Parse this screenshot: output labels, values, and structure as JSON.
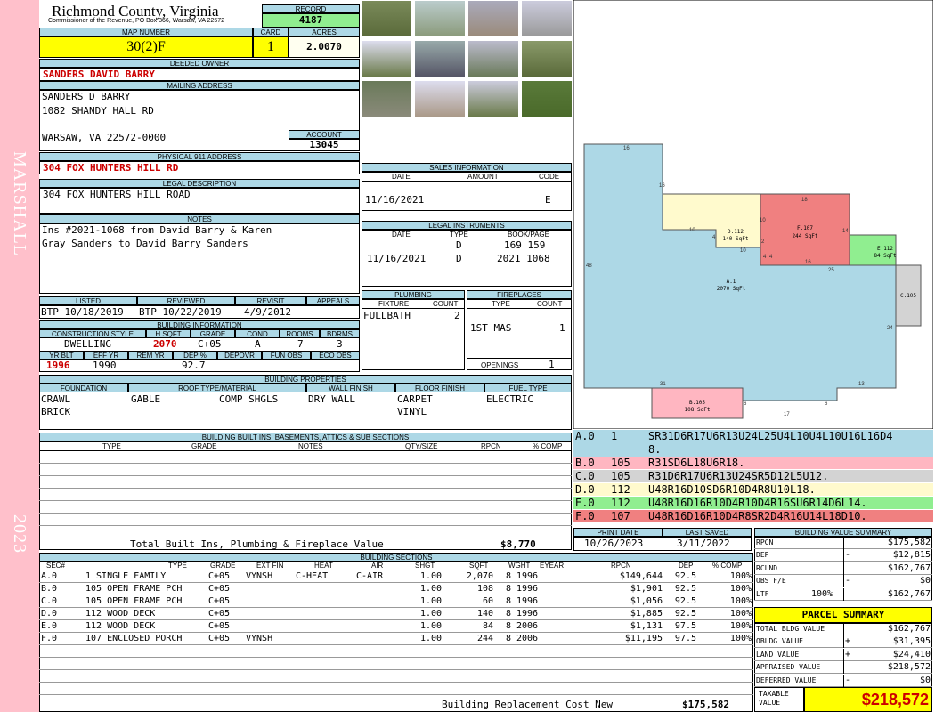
{
  "sidebar": {
    "district": "MARSHALL",
    "year": "2023"
  },
  "header": {
    "county": "Richmond County, Virginia",
    "commissioner": "Commissioner of the Revenue, PO Box 366, Warsaw, VA 22572"
  },
  "record": {
    "label": "RECORD",
    "value": "4187"
  },
  "map": {
    "label": "MAP NUMBER",
    "value": "30(2)F",
    "card_label": "CARD",
    "card": "1",
    "acres_label": "ACRES",
    "acres": "2.0070"
  },
  "owner": {
    "label": "DEEDED OWNER",
    "value": "SANDERS DAVID BARRY"
  },
  "mailing": {
    "label": "MAILING ADDRESS",
    "line1": "SANDERS D BARRY",
    "line2": "1082 SHANDY HALL RD",
    "line3": "WARSAW, VA 22572-0000"
  },
  "account": {
    "label": "ACCOUNT",
    "value": "13045"
  },
  "physical": {
    "label": "PHYSICAL 911 ADDRESS",
    "value": "304 FOX HUNTERS HILL RD"
  },
  "legal": {
    "label": "LEGAL DESCRIPTION",
    "value": "304 FOX HUNTERS HILL ROAD"
  },
  "notes": {
    "label": "NOTES",
    "line1": "Ins #2021-1068 from David Barry & Karen",
    "line2": "Gray Sanders to David Barry Sanders"
  },
  "sales": {
    "label": "SALES INFORMATION",
    "cols": [
      "DATE",
      "AMOUNT",
      "CODE"
    ],
    "date": "11/16/2021",
    "code": "E"
  },
  "instruments": {
    "label": "LEGAL INSTRUMENTS",
    "cols": [
      "DATE",
      "TYPE",
      "BOOK/PAGE"
    ],
    "rows": [
      {
        "date": "",
        "type": "D",
        "book": "169 159"
      },
      {
        "date": "11/16/2021",
        "type": "D",
        "book": "2021 1068"
      }
    ]
  },
  "listing": {
    "listed_label": "LISTED",
    "listed": "BTP 10/18/2019",
    "reviewed_label": "REVIEWED",
    "reviewed": "BTP 10/22/2019",
    "revisit_label": "REVISIT",
    "revisit": "4/9/2012",
    "appeals_label": "APPEALS",
    "appeals": ""
  },
  "building_info": {
    "label": "BUILDING INFORMATION",
    "cols": [
      "CONSTRUCTION STYLE",
      "H SQFT",
      "GRADE",
      "COND",
      "ROOMS",
      "BDRMS"
    ],
    "style": "DWELLING",
    "hsqft": "2070",
    "grade": "C+05",
    "cond": "A",
    "rooms": "7",
    "bdrms": "3",
    "cols2": [
      "YR BLT",
      "EFF YR",
      "REM YR",
      "DEP %",
      "DEPOVR",
      "FUN OBS",
      "ECO OBS"
    ],
    "yrblt": "1996",
    "effyr": "1990",
    "remyr": "",
    "dep": "92.7",
    "depovr": "",
    "funobs": "",
    "ecoobs": ""
  },
  "plumbing": {
    "label": "PLUMBING",
    "cols": [
      "FIXTURE",
      "COUNT"
    ],
    "fixture": "FULLBATH",
    "count": "2"
  },
  "fireplaces": {
    "label": "FIREPLACES",
    "cols": [
      "TYPE",
      "COUNT"
    ],
    "type": "1ST MAS",
    "count": "1",
    "openings_label": "OPENINGS",
    "openings": "1"
  },
  "properties": {
    "label": "BUILDING PROPERTIES",
    "cols": [
      "FOUNDATION",
      "ROOF TYPE/MATERIAL",
      "WALL FINISH",
      "FLOOR FINISH",
      "FUEL TYPE"
    ],
    "foundation1": "CRAWL",
    "foundation2": "BRICK",
    "roof1": "GABLE",
    "roof2": "COMP SHGLS",
    "wall": "DRY WALL",
    "floor1": "CARPET",
    "floor2": "VINYL",
    "fuel": "ELECTRIC"
  },
  "builtins": {
    "label": "BUILDING BUILT INS, BASEMENTS, ATTICS & SUB SECTIONS",
    "cols": [
      "TYPE",
      "GRADE",
      "NOTES",
      "QTY/SIZE",
      "RPCN",
      "% COMP"
    ],
    "total_label": "Total Built Ins, Plumbing & Fireplace Value",
    "total": "$8,770"
  },
  "sketch": {
    "areas": [
      {
        "code": "A.1",
        "sqft": "2070 SqFt"
      },
      {
        "code": "B.105",
        "sqft": "108 SqFt"
      },
      {
        "code": "C.105",
        "sqft": ""
      },
      {
        "code": "D.112",
        "sqft": "140 SqFt"
      },
      {
        "code": "E.112",
        "sqft": "84 SqFt"
      },
      {
        "code": "F.107",
        "sqft": "244 SqFt"
      }
    ],
    "dims": [
      "16",
      "16",
      "10",
      "4",
      "10",
      "2",
      "18",
      "10",
      "14",
      "4",
      "4",
      "16",
      "25",
      "48",
      "24",
      "31",
      "13",
      "6",
      "6",
      "17"
    ]
  },
  "vectors": [
    {
      "id": "A.0",
      "code": "1",
      "text": "SR31D6R17U6R13U24L25U4L10U4L10U16L16D4",
      "text2": "8.",
      "color": "#add8e6"
    },
    {
      "id": "B.0",
      "code": "105",
      "text": "R31SD6L18U6R18.",
      "color": "#ffb6c1"
    },
    {
      "id": "C.0",
      "code": "105",
      "text": "R31D6R17U6R13U24SR5D12L5U12.",
      "color": "#d3d3d3"
    },
    {
      "id": "D.0",
      "code": "112",
      "text": "U48R16D10SD6R10D4R8U10L18.",
      "color": "#fffacd"
    },
    {
      "id": "E.0",
      "code": "112",
      "text": "U48R16D16R10D4R10D4R16SU6R14D6L14.",
      "color": "#90ee90"
    },
    {
      "id": "F.0",
      "code": "107",
      "text": "U48R16D16R10D4R8SR2D4R16U14L18D10.",
      "color": "#f08080"
    }
  ],
  "print": {
    "label": "PRINT DATE",
    "value": "10/26/2023",
    "saved_label": "LAST SAVED",
    "saved": "3/11/2022"
  },
  "sections": {
    "label": "BUILDING SECTIONS",
    "cols": [
      "SEC#",
      "TYPE",
      "GRADE",
      "EXT FIN",
      "HEAT",
      "AIR",
      "SHGT",
      "SQFT",
      "WGHT",
      "EYEAR",
      "RPCN",
      "DEP",
      "% COMP"
    ],
    "rows": [
      {
        "sec": "A.0",
        "type": "1 SINGLE FAMILY",
        "grade": "C+05",
        "ext": "VYNSH",
        "heat": "C-HEAT",
        "air": "C-AIR",
        "shgt": "1.00",
        "sqft": "2,070",
        "wght": "8",
        "eyear": "1996",
        "rpcn": "$149,644",
        "dep": "92.5",
        "comp": "100%"
      },
      {
        "sec": "B.0",
        "type": "105 OPEN FRAME PCH",
        "grade": "C+05",
        "ext": "",
        "heat": "",
        "air": "",
        "shgt": "1.00",
        "sqft": "108",
        "wght": "8",
        "eyear": "1996",
        "rpcn": "$1,901",
        "dep": "92.5",
        "comp": "100%"
      },
      {
        "sec": "C.0",
        "type": "105 OPEN FRAME PCH",
        "grade": "C+05",
        "ext": "",
        "heat": "",
        "air": "",
        "shgt": "1.00",
        "sqft": "60",
        "wght": "8",
        "eyear": "1996",
        "rpcn": "$1,056",
        "dep": "92.5",
        "comp": "100%"
      },
      {
        "sec": "D.0",
        "type": "112 WOOD DECK",
        "grade": "C+05",
        "ext": "",
        "heat": "",
        "air": "",
        "shgt": "1.00",
        "sqft": "140",
        "wght": "8",
        "eyear": "1996",
        "rpcn": "$1,885",
        "dep": "92.5",
        "comp": "100%"
      },
      {
        "sec": "E.0",
        "type": "112 WOOD DECK",
        "grade": "C+05",
        "ext": "",
        "heat": "",
        "air": "",
        "shgt": "1.00",
        "sqft": "84",
        "wght": "8",
        "eyear": "2006",
        "rpcn": "$1,131",
        "dep": "97.5",
        "comp": "100%"
      },
      {
        "sec": "F.0",
        "type": "107 ENCLOSED PORCH",
        "grade": "C+05",
        "ext": "VYNSH",
        "heat": "",
        "air": "",
        "shgt": "1.00",
        "sqft": "244",
        "wght": "8",
        "eyear": "2006",
        "rpcn": "$11,195",
        "dep": "97.5",
        "comp": "100%"
      }
    ],
    "total_label": "Building Replacement Cost New",
    "total": "$175,582"
  },
  "value_summary": {
    "label": "BUILDING VALUE SUMMARY",
    "rows": [
      {
        "k": "RPCN",
        "s": "",
        "v": "$175,582"
      },
      {
        "k": "DEP",
        "s": "-",
        "v": "$12,815"
      },
      {
        "k": "RCLND",
        "s": "",
        "v": "$162,767"
      },
      {
        "k": "OBS F/E",
        "s": "-",
        "v": "$0"
      },
      {
        "k": "LTF",
        "s": "100%",
        "v": "$162,767"
      }
    ]
  },
  "parcel": {
    "label": "PARCEL SUMMARY",
    "rows": [
      {
        "k": "TOTAL BLDG VALUE",
        "s": "",
        "v": "$162,767"
      },
      {
        "k": "OBLDG VALUE",
        "s": "+",
        "v": "$31,395"
      },
      {
        "k": "LAND VALUE",
        "s": "+",
        "v": "$24,410"
      },
      {
        "k": "APPRAISED VALUE",
        "s": "",
        "v": "$218,572"
      },
      {
        "k": "DEFERRED VALUE",
        "s": "-",
        "v": "$0"
      }
    ],
    "taxable_label1": "TAXABLE",
    "taxable_label2": "VALUE",
    "taxable": "$218,572"
  },
  "colors": {
    "sidebar": "#ffc0cb",
    "header_blue": "#add8e6",
    "highlight_yellow": "#ffff00",
    "record_green": "#90ee90",
    "red_text": "#cc0000"
  }
}
